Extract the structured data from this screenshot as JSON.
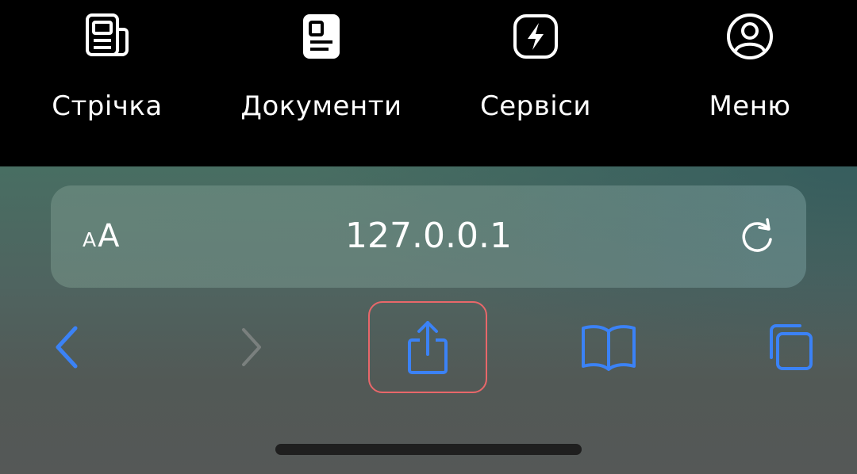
{
  "app_tabs": [
    {
      "label": "Стрічка",
      "icon": "feed-newspaper-icon"
    },
    {
      "label": "Документи",
      "icon": "documents-id-card-icon"
    },
    {
      "label": "Сервіси",
      "icon": "services-lightning-icon"
    },
    {
      "label": "Меню",
      "icon": "menu-profile-icon"
    }
  ],
  "browser": {
    "reader_small": "A",
    "reader_large": "A",
    "url": "127.0.0.1",
    "nav": {
      "back_icon": "chevron-left-icon",
      "forward_icon": "chevron-right-icon",
      "share_icon": "share-icon",
      "bookmarks_icon": "book-icon",
      "tabs_icon": "tabs-icon"
    },
    "share_highlighted": true
  },
  "colors": {
    "tabbar_bg": "#000000",
    "tab_text": "#ffffff",
    "accent_blue": "#3b82f6",
    "disabled_gray": "#8a8f8d",
    "highlight_red": "#e8676a"
  }
}
